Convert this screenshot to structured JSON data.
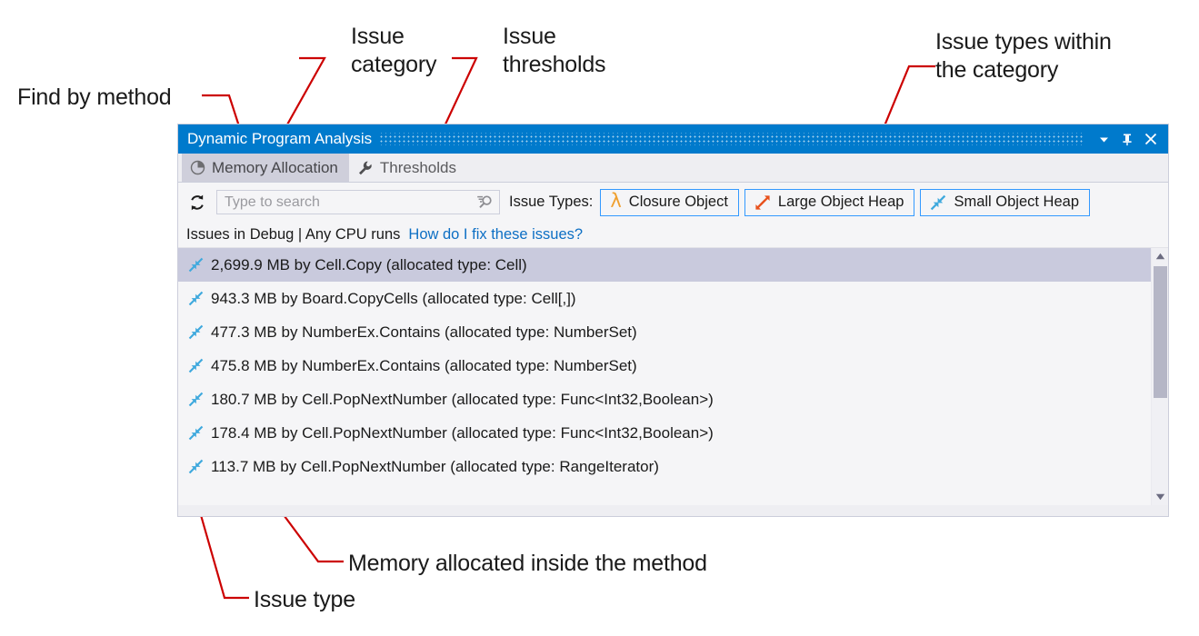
{
  "annotations": [
    {
      "id": "find-by-method",
      "text": "Find by method"
    },
    {
      "id": "issue-category",
      "text": "Issue\ncategory"
    },
    {
      "id": "issue-thresholds",
      "text": "Issue\nthresholds"
    },
    {
      "id": "issue-types-within",
      "text": "Issue types within\nthe category"
    },
    {
      "id": "memory-allocated",
      "text": "Memory allocated inside the method"
    },
    {
      "id": "issue-type",
      "text": "Issue type"
    }
  ],
  "annotation_color": "#cc0000",
  "window": {
    "title": "Dynamic Program Analysis",
    "titlebar_color": "#007acc",
    "controls": {
      "dropdown": "chevron-down",
      "pin": "pin",
      "close": "close"
    }
  },
  "tabs": [
    {
      "label": "Memory Allocation",
      "icon": "pie-chart-icon",
      "active": true
    },
    {
      "label": "Thresholds",
      "icon": "wrench-icon",
      "active": false
    }
  ],
  "toolbar": {
    "refresh_icon": "refresh-icon",
    "search": {
      "value": "",
      "placeholder": "Type to search",
      "icon": "search-dropdown-icon"
    },
    "issue_types_label": "Issue Types:",
    "issue_type_buttons": [
      {
        "label": "Closure Object",
        "icon": "lambda-icon",
        "icon_color": "#f0a030",
        "active": true
      },
      {
        "label": "Large Object Heap",
        "icon": "arrows-outward-icon",
        "icon_color": "#e8521e",
        "active": true
      },
      {
        "label": "Small Object Heap",
        "icon": "arrows-inward-icon",
        "icon_color": "#3fa9dd",
        "active": true
      }
    ],
    "button_border_color": "#3399ff"
  },
  "subheader": {
    "scope_text": "Issues in Debug | Any CPU runs",
    "link_text": "How do I fix these issues?",
    "link_color": "#0d6fc4"
  },
  "issues": [
    {
      "icon": "arrows-inward-icon",
      "text": "2,699.9 MB by Cell.Copy (allocated type: Cell)",
      "selected": true
    },
    {
      "icon": "arrows-inward-icon",
      "text": "943.3 MB by Board.CopyCells (allocated type: Cell[,])",
      "selected": false
    },
    {
      "icon": "arrows-inward-icon",
      "text": "477.3 MB by NumberEx.Contains (allocated type: NumberSet)",
      "selected": false
    },
    {
      "icon": "arrows-inward-icon",
      "text": "475.8 MB by NumberEx.Contains (allocated type: NumberSet)",
      "selected": false
    },
    {
      "icon": "arrows-inward-icon",
      "text": "180.7 MB by Cell.PopNextNumber (allocated type: Func<Int32,Boolean>)",
      "selected": false
    },
    {
      "icon": "arrows-inward-icon",
      "text": "178.4 MB by Cell.PopNextNumber (allocated type: Func<Int32,Boolean>)",
      "selected": false
    },
    {
      "icon": "arrows-inward-icon",
      "text": "113.7 MB by Cell.PopNextNumber (allocated type: RangeIterator)",
      "selected": false
    }
  ],
  "scrollbar": {
    "up_arrow": "triangle-up-icon",
    "down_arrow": "triangle-down-icon",
    "thumb_color": "#b5b6c6"
  }
}
